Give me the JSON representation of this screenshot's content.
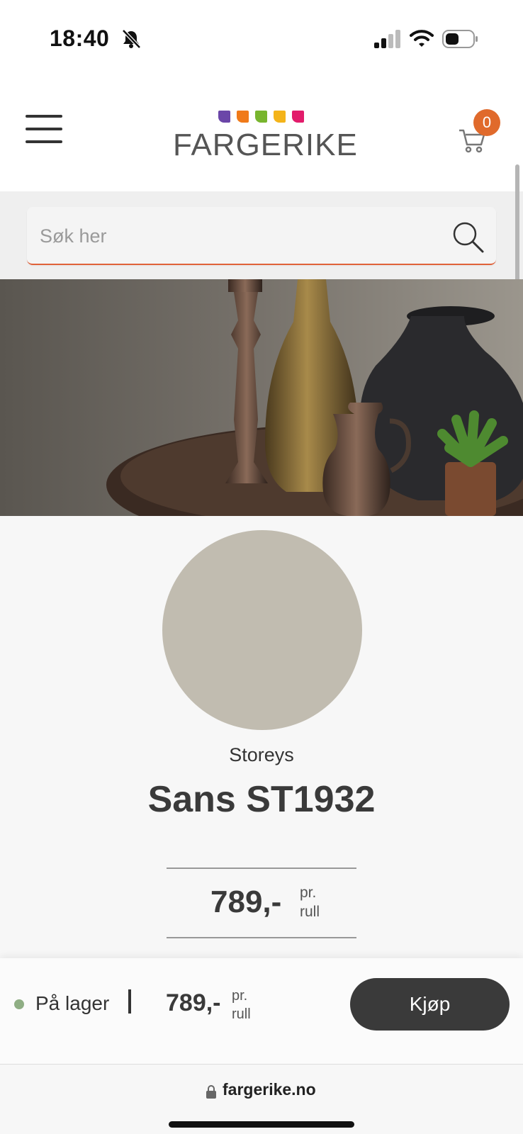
{
  "status_bar": {
    "time": "18:40",
    "icons": [
      "bell-slash-icon",
      "signal-icon",
      "wifi-icon",
      "battery-icon"
    ]
  },
  "header": {
    "logo_text": "FARGERIKE",
    "logo_dot_colors": [
      "#6b46a8",
      "#f07a1a",
      "#78b52e",
      "#f4b41a",
      "#e21c6b"
    ],
    "cart_count": "0"
  },
  "search": {
    "placeholder": "Søk her",
    "value": ""
  },
  "hero": {
    "slide_count": 2,
    "active_slide": 2
  },
  "product": {
    "swatch_color": "#c1bcb0",
    "brand": "Storeys",
    "title": "Sans ST1932",
    "price": "789,-",
    "price_unit_line1": "pr.",
    "price_unit_line2": "rull"
  },
  "buy_bar": {
    "stock_text": "På lager",
    "stock_color": "#8fae84",
    "price": "789,-",
    "price_unit_line1": "pr.",
    "price_unit_line2": "rull",
    "buy_label": "Kjøp"
  },
  "browser": {
    "url": "fargerike.no"
  },
  "colors": {
    "accent": "#e0623a",
    "badge": "#e06a2c",
    "button": "#3a3a3a"
  }
}
